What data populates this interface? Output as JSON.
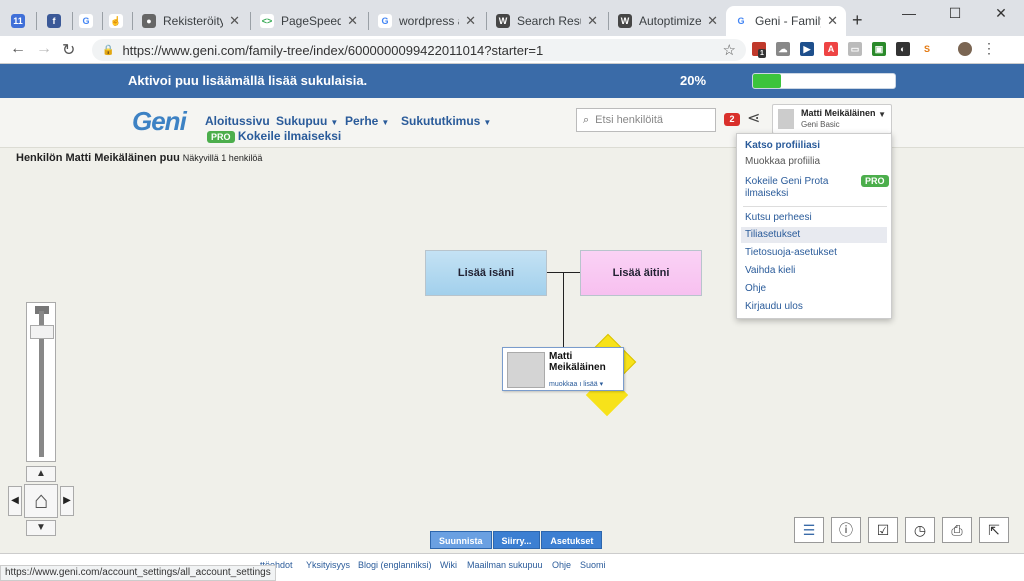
{
  "browser": {
    "tabs": [
      {
        "label": "",
        "icon": "calendar-icon",
        "color": "#3f6fd8",
        "pinned": true
      },
      {
        "label": "",
        "icon": "facebook-icon",
        "color": "#3b5998",
        "pinned": true
      },
      {
        "label": "",
        "icon": "google-icon",
        "color": "#4285f4",
        "pinned": true
      },
      {
        "label": "",
        "icon": "hand-icon",
        "color": "#5577aa",
        "pinned": true
      },
      {
        "label": "Rekisteröitymin",
        "icon": "globe-icon",
        "color": "#666666"
      },
      {
        "label": "PageSpeed Insi",
        "icon": "pagespeed-icon",
        "color": "#34a853"
      },
      {
        "label": "wordpress add",
        "icon": "google-icon",
        "color": "#4285f4"
      },
      {
        "label": "Search Results",
        "icon": "wordpress-icon",
        "color": "#464646"
      },
      {
        "label": "Autoptimize – V",
        "icon": "wordpress-icon",
        "color": "#464646"
      },
      {
        "label": "Geni - Family Tr",
        "icon": "google-icon",
        "color": "#4285f4",
        "active": true
      }
    ],
    "url": "https://www.geni.com/family-tree/index/6000000099422011014?starter=1",
    "status_url": "https://www.geni.com/account_settings/all_account_settings",
    "ext_badge": "1"
  },
  "progress": {
    "text": "Aktivoi puu lisäämällä lisää sukulaisia.",
    "percent_label": "20%",
    "value": 0.2
  },
  "header": {
    "logo": "Geni",
    "nav": [
      "Aloitussivu",
      "Sukupuu",
      "Perhe",
      "Sukututkimus"
    ],
    "pro_badge": "PRO",
    "try_free": "Kokeile ilmaiseksi",
    "search_placeholder": "Etsi henkilöitä",
    "notif_count": "2",
    "user_name": "Matti Meikäläinen",
    "user_plan": "Geni Basic"
  },
  "dropdown": {
    "view_profile": "Katso profiiliasi",
    "edit_profile": "Muokkaa profiilia",
    "try_pro": "Kokeile Geni Prota ilmaiseksi",
    "pro_badge": "PRO",
    "items": [
      "Kutsu perheesi",
      "Tiliasetukset",
      "Tietosuoja-asetukset",
      "Vaihda kieli",
      "Ohje",
      "Kirjaudu ulos"
    ]
  },
  "tree": {
    "title": "Henkilön Matti Meikäläinen puu",
    "subtitle": "Näkyvillä 1 henkilöä",
    "add_father": "Lisää isäni",
    "add_mother": "Lisää äitini",
    "person_first": "Matti",
    "person_last": "Meikäläinen",
    "person_actions": "muokkaa ı lisää ▾"
  },
  "bottom_tabs": [
    "Suunnista",
    "Siirry...",
    "Asetukset"
  ],
  "footer": {
    "links": [
      "Yksityisyys",
      "Blogi (englanniksi)",
      "Wiki",
      "Maailman sukupuu",
      "Ohje",
      "Suomi"
    ],
    "partial": "ttöehdot"
  }
}
